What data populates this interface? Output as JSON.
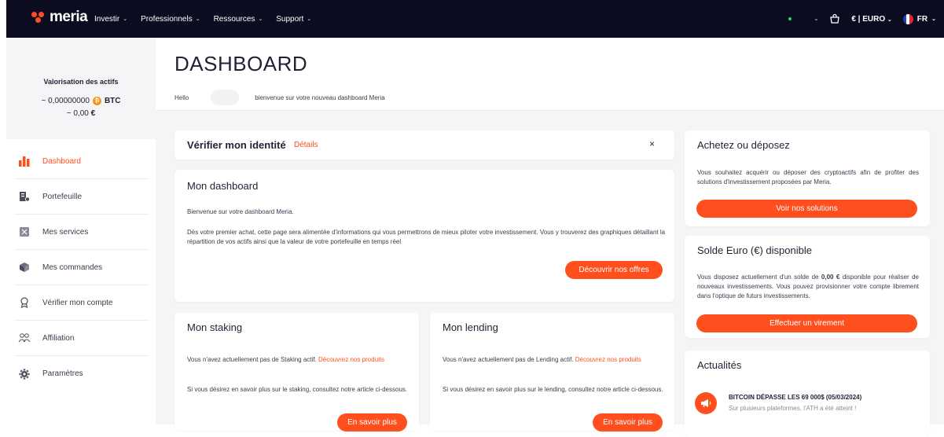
{
  "brand": {
    "name": "meria",
    "accent": "#ff4f1f",
    "navbar_bg": "#0b0c1f"
  },
  "nav": {
    "items": [
      {
        "label": "Investir"
      },
      {
        "label": "Professionnels"
      },
      {
        "label": "Ressources"
      },
      {
        "label": "Support"
      }
    ],
    "currency": "€ | EURO",
    "language": "FR"
  },
  "valuation": {
    "title": "Valorisation des actifs",
    "btc_prefix": "~ 0,00000000",
    "btc_unit": "BTC",
    "eur_prefix": "~ 0,00",
    "eur_unit": "€"
  },
  "sidebar": {
    "items": [
      {
        "label": "Dashboard",
        "icon": "bar-chart-icon",
        "active": true
      },
      {
        "label": "Portefeuille",
        "icon": "wallet-icon"
      },
      {
        "label": "Mes services",
        "icon": "services-icon"
      },
      {
        "label": "Mes commandes",
        "icon": "box-icon"
      },
      {
        "label": "Vérifier mon compte",
        "icon": "badge-icon"
      },
      {
        "label": "Affiliation",
        "icon": "users-icon"
      },
      {
        "label": "Paramètres",
        "icon": "gear-icon"
      }
    ]
  },
  "header": {
    "title": "DASHBOARD",
    "hello": "Hello",
    "welcome": "bienvenue sur votre nouveau dashboard Meria"
  },
  "verify": {
    "title": "Vérifier mon identité",
    "link": "Détails",
    "close": "×"
  },
  "dashboard_card": {
    "title": "Mon dashboard",
    "line1": "Bienvenue sur votre dashboard Meria.",
    "line2": "Dès votre premier achat, cette page sera alimentée d'informations qui vous permettrons de mieux piloter votre investissement. Vous y trouverez des graphiques détaillant la répartition de vos actifs ainsi que la valeur de votre portefeuille en temps réel",
    "button": "Découvrir nos offres"
  },
  "staking": {
    "title": "Mon staking",
    "text": "Vous n'avez actuellement pas de Staking actif.",
    "link": "Découvrez nos produits",
    "info": "Si vous désirez en savoir plus sur le staking, consultez notre article ci-dessous.",
    "button": "En savoir plus"
  },
  "lending": {
    "title": "Mon lending",
    "text": "Vous n'avez actuellement pas de Lending actif.",
    "link": "Découvrez nos produits",
    "info": "Si vous désirez en savoir plus sur le lending, consultez notre article ci-dessous.",
    "button": "En savoir plus"
  },
  "buy": {
    "title": "Achetez ou déposez",
    "text": "Vous souhaitez acquérir ou déposer des cryptoactifs afin de profiter des solutions d'investissement proposées par Meria.",
    "button": "Voir nos solutions"
  },
  "balance": {
    "title": "Solde Euro (€) disponible",
    "text_before": "Vous disposez actuellement d'un solde de",
    "amount": "0,00 €",
    "text_after": "disponible pour réaliser de nouveaux investissements. Vous pouvez provisionner votre compte librement dans l'optique de futurs investissements.",
    "button": "Effectuer un virement"
  },
  "news": {
    "title": "Actualités",
    "items": [
      {
        "headline": "BITCOIN DÉPASSE LES 69 000$ (05/03/2024)",
        "summary": "Sur plusieurs plateformes, l'ATH a été atteint !"
      }
    ]
  }
}
